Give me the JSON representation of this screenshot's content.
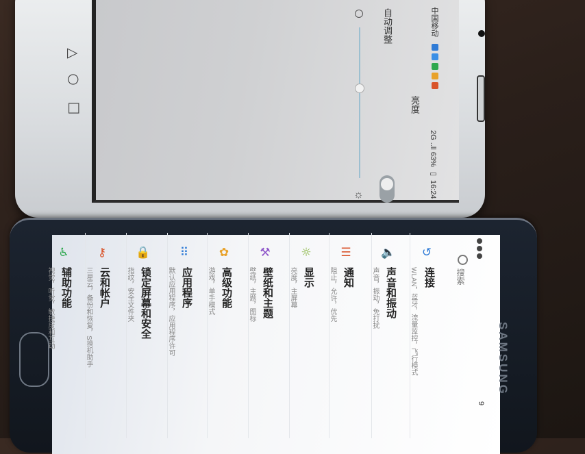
{
  "top_phone": {
    "status_carrier": "中国移动",
    "status_right": "2G ..ll 63% ▭ 16:24",
    "auto_adjust_label": "自动调整",
    "brightness_label": "亮度",
    "app_dot_colors": [
      "#2f7bd6",
      "#3a8fe6",
      "#2fa84f",
      "#e8a22b",
      "#d9542b"
    ]
  },
  "bottom_phone": {
    "brand": "SAMSUNG",
    "search_label": "搜索",
    "status_time": "9",
    "menu": [
      {
        "icon": "wifi-icon",
        "glyph": "↺",
        "color": "#2f7bd6",
        "title": "连接",
        "subtitle": "WLAN，蓝牙，流量监控，飞行模式"
      },
      {
        "icon": "speaker-icon",
        "glyph": "🔈",
        "color": "#2f7bd6",
        "title": "声音和振动",
        "subtitle": "声音，振动，免打扰"
      },
      {
        "icon": "notification-icon",
        "glyph": "☰",
        "color": "#d9542b",
        "title": "通知",
        "subtitle": "阻止，允许，优先"
      },
      {
        "icon": "display-icon",
        "glyph": "☼",
        "color": "#7cae2e",
        "title": "显示",
        "subtitle": "亮度，主屏幕"
      },
      {
        "icon": "brush-icon",
        "glyph": "⚒",
        "color": "#8e55c9",
        "title": "壁纸和主题",
        "subtitle": "壁纸，主题，图标"
      },
      {
        "icon": "advanced-icon",
        "glyph": "✿",
        "color": "#e8a22b",
        "title": "高级功能",
        "subtitle": "游戏，单手模式"
      },
      {
        "icon": "apps-icon",
        "glyph": "⠿",
        "color": "#2f7bd6",
        "title": "应用程序",
        "subtitle": "默认应用程序，应用程序许可"
      },
      {
        "icon": "lock-icon",
        "glyph": "🔒",
        "color": "#8e55c9",
        "title": "锁定屏幕和安全",
        "subtitle": "指纹，安全文件夹"
      },
      {
        "icon": "key-icon",
        "glyph": "⚷",
        "color": "#d9542b",
        "title": "云和帐户",
        "subtitle": "三星云，备份和恢复，S换机助手"
      },
      {
        "icon": "accessibility-icon",
        "glyph": "♿",
        "color": "#2fa84f",
        "title": "辅助功能",
        "subtitle": "视觉，听觉，敏捷度和互动"
      }
    ]
  }
}
